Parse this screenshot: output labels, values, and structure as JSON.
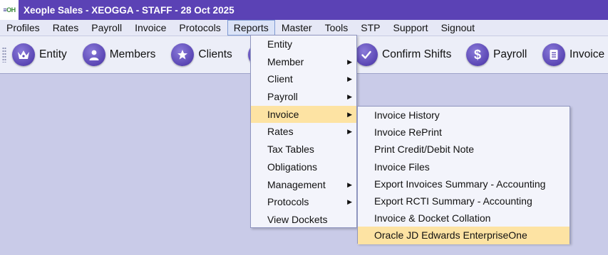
{
  "app": {
    "logo_text_a": "≡",
    "logo_text_b": "OH",
    "title": "Xeople Sales - XEOGGA - STAFF - 28 Oct 2025"
  },
  "menubar": [
    {
      "label": "Profiles"
    },
    {
      "label": "Rates"
    },
    {
      "label": "Payroll"
    },
    {
      "label": "Invoice"
    },
    {
      "label": "Protocols"
    },
    {
      "label": "Reports"
    },
    {
      "label": "Master"
    },
    {
      "label": "Tools"
    },
    {
      "label": "STP"
    },
    {
      "label": "Support"
    },
    {
      "label": "Signout"
    }
  ],
  "toolbar": {
    "entity": {
      "label": "Entity",
      "icon": "crown-icon"
    },
    "members": {
      "label": "Members",
      "icon": "person-icon"
    },
    "clients": {
      "label": "Clients",
      "icon": "star-icon"
    },
    "confirm_shifts": {
      "label": "Confirm Shifts",
      "icon": "check-icon"
    },
    "payroll": {
      "label": "Payroll",
      "icon": "dollar-icon"
    },
    "invoice": {
      "label": "Invoice",
      "icon": "document-icon"
    }
  },
  "reports_menu": [
    {
      "label": "Entity",
      "submenu": false
    },
    {
      "label": "Member",
      "submenu": true
    },
    {
      "label": "Client",
      "submenu": true
    },
    {
      "label": "Payroll",
      "submenu": true
    },
    {
      "label": "Invoice",
      "submenu": true,
      "highlighted": true
    },
    {
      "label": "Rates",
      "submenu": true
    },
    {
      "label": "Tax Tables",
      "submenu": false
    },
    {
      "label": "Obligations",
      "submenu": false
    },
    {
      "label": "Management",
      "submenu": true
    },
    {
      "label": "Protocols",
      "submenu": true
    },
    {
      "label": "View Dockets",
      "submenu": false
    }
  ],
  "invoice_submenu": [
    {
      "label": "Invoice History"
    },
    {
      "label": "Invoice RePrint"
    },
    {
      "label": "Print Credit/Debit Note"
    },
    {
      "label": "Invoice Files"
    },
    {
      "label": "Export Invoices Summary - Accounting"
    },
    {
      "label": "Export RCTI Summary - Accounting"
    },
    {
      "label": "Invoice & Docket Collation"
    },
    {
      "label": "Oracle JD Edwards EnterpriseOne",
      "highlighted": true
    }
  ],
  "colors": {
    "titlebar": "#5b42b5",
    "highlight": "#fde3a3",
    "workarea": "#c9cbe8"
  }
}
